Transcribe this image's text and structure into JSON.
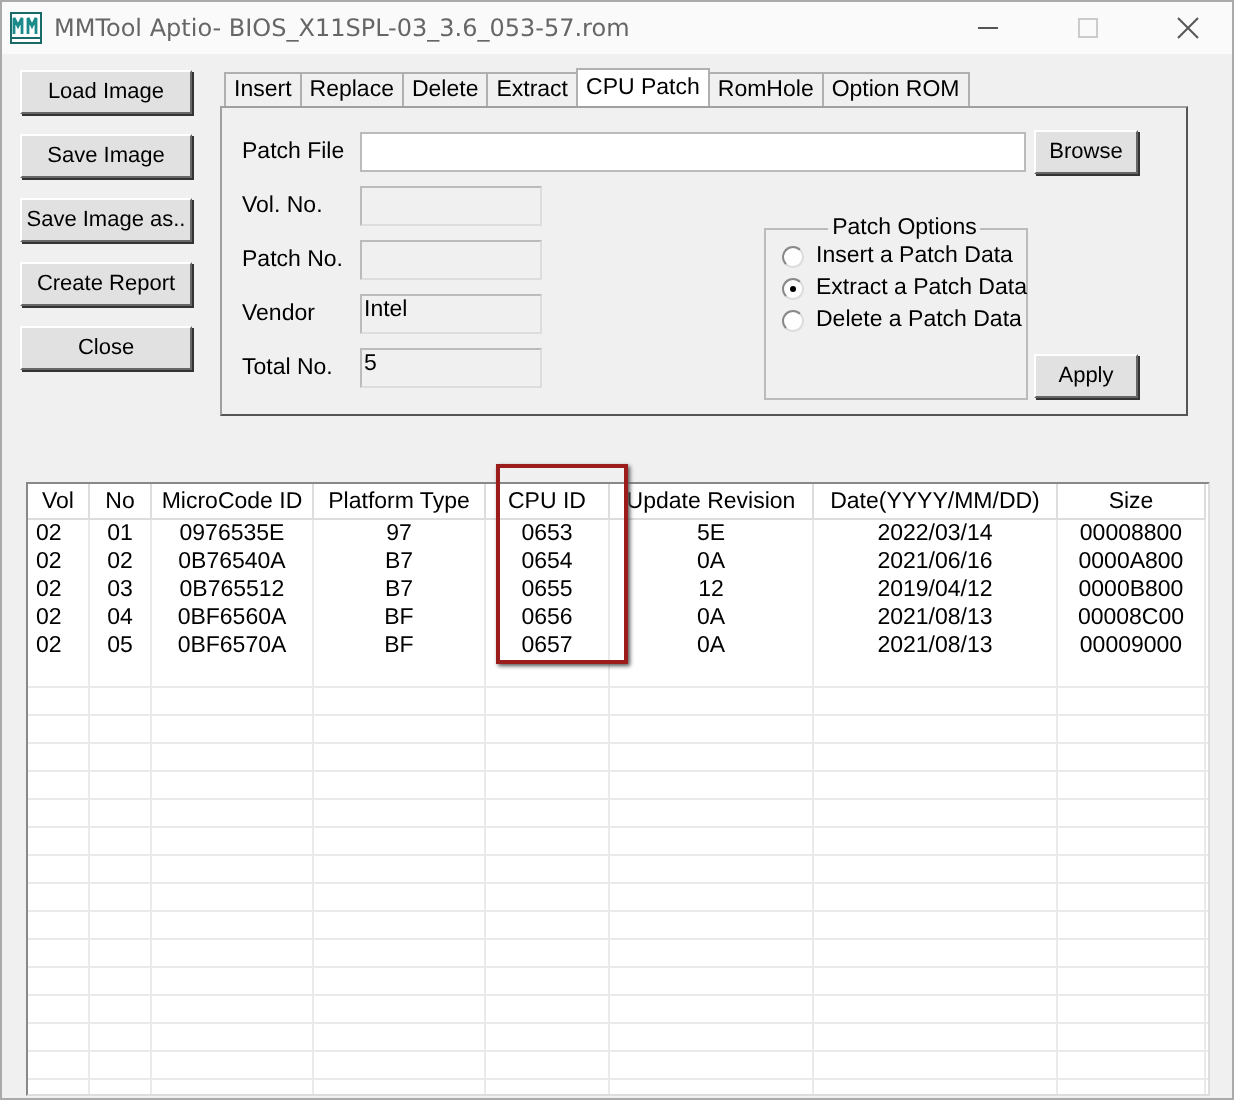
{
  "window": {
    "title": "MMTool Aptio- BIOS_X11SPL-03_3.6_053-57.rom"
  },
  "side_buttons": [
    "Load Image",
    "Save Image",
    "Save Image as..",
    "Create Report",
    "Close"
  ],
  "tabs": [
    {
      "label": "Insert",
      "selected": false
    },
    {
      "label": "Replace",
      "selected": false
    },
    {
      "label": "Delete",
      "selected": false
    },
    {
      "label": "Extract",
      "selected": false
    },
    {
      "label": "CPU Patch",
      "selected": true
    },
    {
      "label": "RomHole",
      "selected": false
    },
    {
      "label": "Option ROM",
      "selected": false
    }
  ],
  "fields": [
    {
      "label": "Patch File",
      "kind": "file"
    },
    {
      "label": "Vol. No.",
      "kind": "readonly"
    },
    {
      "label": "Patch No.",
      "kind": "readonly"
    },
    {
      "label": "Vendor",
      "value": "Intel",
      "kind": "readonly"
    },
    {
      "label": "Total No.",
      "value": "5",
      "kind": "readonly"
    }
  ],
  "browse_button": "Browse",
  "patch_options": {
    "title": "Patch Options",
    "options": [
      {
        "label": "Insert a Patch Data",
        "selected": false
      },
      {
        "label": "Extract a Patch Data",
        "selected": true
      },
      {
        "label": "Delete a Patch Data",
        "selected": false
      }
    ]
  },
  "apply_button": "Apply",
  "table": {
    "columns": [
      {
        "label": "Vol",
        "highlighted": false
      },
      {
        "label": "No",
        "highlighted": false
      },
      {
        "label": "MicroCode ID",
        "highlighted": false
      },
      {
        "label": "Platform Type",
        "highlighted": false
      },
      {
        "label": "CPU ID",
        "highlighted": true
      },
      {
        "label": "Update Revision",
        "highlighted": false
      },
      {
        "label": "Date(YYYY/MM/DD)",
        "highlighted": false
      },
      {
        "label": "Size",
        "highlighted": false
      }
    ],
    "rows": [
      [
        "02",
        "01",
        "0976535E",
        "97",
        "0653",
        "5E",
        "2022/03/14",
        "00008800"
      ],
      [
        "02",
        "02",
        "0B76540A",
        "B7",
        "0654",
        "0A",
        "2021/06/16",
        "0000A800"
      ],
      [
        "02",
        "03",
        "0B765512",
        "B7",
        "0655",
        "12",
        "2019/04/12",
        "0000B800"
      ],
      [
        "02",
        "04",
        "0BF6560A",
        "BF",
        "0656",
        "0A",
        "2021/08/13",
        "00008C00"
      ],
      [
        "02",
        "05",
        "0BF6570A",
        "BF",
        "0657",
        "0A",
        "2021/08/13",
        "00009000"
      ]
    ]
  }
}
